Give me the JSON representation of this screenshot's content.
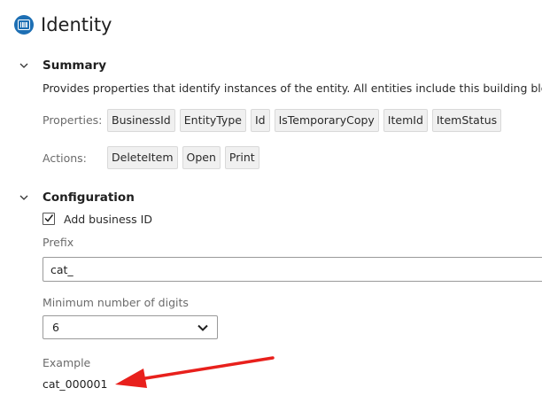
{
  "header": {
    "title": "Identity",
    "icon": "barcode-icon"
  },
  "summary": {
    "title": "Summary",
    "description": "Provides properties that identify instances of the entity. All entities include this building block.",
    "properties_label": "Properties:",
    "properties": [
      "BusinessId",
      "EntityType",
      "Id",
      "IsTemporaryCopy",
      "ItemId",
      "ItemStatus"
    ],
    "actions_label": "Actions:",
    "actions": [
      "DeleteItem",
      "Open",
      "Print"
    ]
  },
  "configuration": {
    "title": "Configuration",
    "add_business_id_label": "Add business ID",
    "add_business_id_checked": true,
    "prefix_label": "Prefix",
    "prefix_value": "cat_",
    "min_digits_label": "Minimum number of digits",
    "min_digits_value": "6",
    "example_label": "Example",
    "example_value": "cat_000001"
  },
  "colors": {
    "accent": "#1d6fb4",
    "annotation_arrow": "#e8201c"
  }
}
